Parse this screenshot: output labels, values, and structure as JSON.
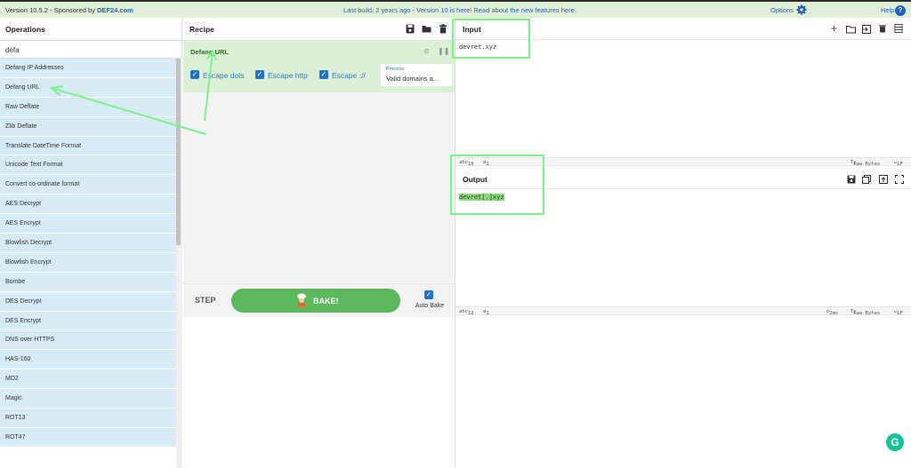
{
  "banner": {
    "version_prefix": "Version 10.5.2 - Sponsored by ",
    "sponsor": "DEF24.com",
    "notice": "Last build: 2 years ago - Version 10 is here! Read about the new features here",
    "options_label": "Options",
    "help_label": "Help"
  },
  "operations": {
    "title": "Operations",
    "search_value": "defa",
    "items": [
      "Defang IP Addresses",
      "Defang URL",
      "Raw Deflate",
      "Zlib Deflate",
      "Translate DateTime Format",
      "Unicode Text Format",
      "Convert co-ordinate format",
      "AES Decrypt",
      "AES Encrypt",
      "Blowfish Decrypt",
      "Blowfish Encrypt",
      "Bombe",
      "DES Decrypt",
      "DES Encrypt",
      "DNS over HTTPS",
      "HAS-160",
      "MD2",
      "Magic",
      "ROT13",
      "ROT47"
    ]
  },
  "recipe": {
    "title": "Recipe",
    "operation_title": "Defang URL",
    "options": {
      "escape_dots": "Escape dots",
      "escape_http": "Escape http",
      "escape_slashes": "Escape ://",
      "process_caption": "Process",
      "process_value": "Valid domains a..."
    },
    "step_label": "STEP",
    "bake_label": "BAKE!",
    "auto_bake_label": "Auto Bake"
  },
  "input": {
    "title": "Input",
    "value": "devret.xyz",
    "status": {
      "length": "10",
      "lines": "1",
      "format": "Raw Bytes",
      "eol": "LF"
    }
  },
  "output": {
    "title": "Output",
    "value": "devret[.]xyz",
    "status": {
      "length": "12",
      "lines": "1",
      "time": "2ms",
      "format": "Raw Bytes",
      "eol": "LF"
    }
  },
  "colors": {
    "banner_bg": "#dfefd8",
    "op_bg": "#d7ebf6",
    "recipe_card_bg": "#dcf0d5",
    "bake_green": "#5cb85c",
    "annotation_green": "#7bf28a",
    "link_blue": "#2a62b0"
  }
}
